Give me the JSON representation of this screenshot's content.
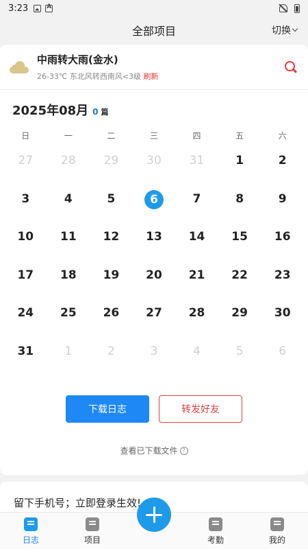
{
  "status": {
    "time": "3:23"
  },
  "header": {
    "title": "全部项目",
    "switch_label": "切换"
  },
  "weather": {
    "summary": "中雨转大雨(金水)",
    "detail": "26-33℃ 东北风转西南风<3级",
    "refresh": "刷新"
  },
  "calendar": {
    "month": "2025年08月",
    "count": "0",
    "count_unit": "篇",
    "weekdays": [
      "日",
      "一",
      "二",
      "三",
      "四",
      "五",
      "六"
    ],
    "days": [
      {
        "d": "27",
        "muted": true
      },
      {
        "d": "28",
        "muted": true
      },
      {
        "d": "29",
        "muted": true
      },
      {
        "d": "30",
        "muted": true
      },
      {
        "d": "31",
        "muted": true
      },
      {
        "d": "1"
      },
      {
        "d": "2"
      },
      {
        "d": "3"
      },
      {
        "d": "4"
      },
      {
        "d": "5"
      },
      {
        "d": "6",
        "today": true
      },
      {
        "d": "7"
      },
      {
        "d": "8"
      },
      {
        "d": "9"
      },
      {
        "d": "10"
      },
      {
        "d": "11"
      },
      {
        "d": "12"
      },
      {
        "d": "13"
      },
      {
        "d": "14"
      },
      {
        "d": "15"
      },
      {
        "d": "16"
      },
      {
        "d": "17"
      },
      {
        "d": "18"
      },
      {
        "d": "19"
      },
      {
        "d": "20"
      },
      {
        "d": "21"
      },
      {
        "d": "22"
      },
      {
        "d": "23"
      },
      {
        "d": "24"
      },
      {
        "d": "25"
      },
      {
        "d": "26"
      },
      {
        "d": "27"
      },
      {
        "d": "28"
      },
      {
        "d": "29"
      },
      {
        "d": "30"
      },
      {
        "d": "31"
      },
      {
        "d": "1",
        "muted": true
      },
      {
        "d": "2",
        "muted": true
      },
      {
        "d": "3",
        "muted": true
      },
      {
        "d": "4",
        "muted": true
      },
      {
        "d": "5",
        "muted": true
      },
      {
        "d": "6",
        "muted": true
      }
    ]
  },
  "actions": {
    "download_log": "下载日志",
    "share_friends": "转发好友",
    "view_downloaded": "查看已下载文件"
  },
  "promo": {
    "text": "留下手机号；立即登录生效!"
  },
  "tabs": [
    {
      "label": "日志",
      "icon": "log-icon",
      "active": true
    },
    {
      "label": "项目",
      "icon": "project-icon"
    },
    {
      "label": "",
      "icon": "add-icon"
    },
    {
      "label": "考勤",
      "icon": "attendance-icon"
    },
    {
      "label": "我的",
      "icon": "profile-icon"
    }
  ],
  "colors": {
    "accent": "#1e88f5",
    "today": "#1e9be8",
    "danger": "#e53935"
  }
}
